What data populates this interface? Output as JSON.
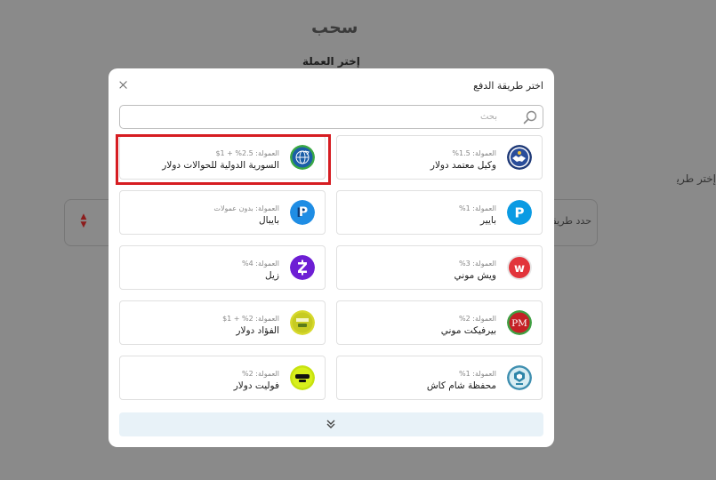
{
  "background": {
    "title": "سحب",
    "currency_label": "إختر العملة",
    "method_label": "إختر طريقة",
    "select_placeholder": "حدد طريقة"
  },
  "modal": {
    "title": "اختر طريقة الدفع",
    "search_placeholder": "بحث",
    "methods": [
      {
        "name": "وكيل معتمد دولار",
        "fee": "العمولة: 1.5%",
        "icon": "agent-handshake-icon"
      },
      {
        "name": "السورية الدولية للحوالات دولار",
        "fee": "العمولة: 2.5% + 1$",
        "icon": "globe-transfer-icon"
      },
      {
        "name": "بايير",
        "fee": "العمولة: 1%",
        "icon": "payeer-icon"
      },
      {
        "name": "بايبال",
        "fee": "العمولة: بدون عمولات",
        "icon": "paypal-icon"
      },
      {
        "name": "ويش موني",
        "fee": "العمولة: 3%",
        "icon": "wish-money-icon"
      },
      {
        "name": "زيل",
        "fee": "العمولة: 4%",
        "icon": "zelle-icon"
      },
      {
        "name": "بيرفيكت موني",
        "fee": "العمولة: 2%",
        "icon": "perfect-money-icon"
      },
      {
        "name": "الفؤاد دولار",
        "fee": "العمولة: 2% + 1$",
        "icon": "alfouad-usd-icon"
      },
      {
        "name": "محفظة شام كاش",
        "fee": "العمولة: 1%",
        "icon": "sham-cash-icon"
      },
      {
        "name": "فوليت دولار",
        "fee": "العمولة: 2%",
        "icon": "volet-usd-icon"
      }
    ]
  },
  "colors": {
    "highlight": "#d61d22",
    "more_button_bg": "#e8f2f8"
  }
}
